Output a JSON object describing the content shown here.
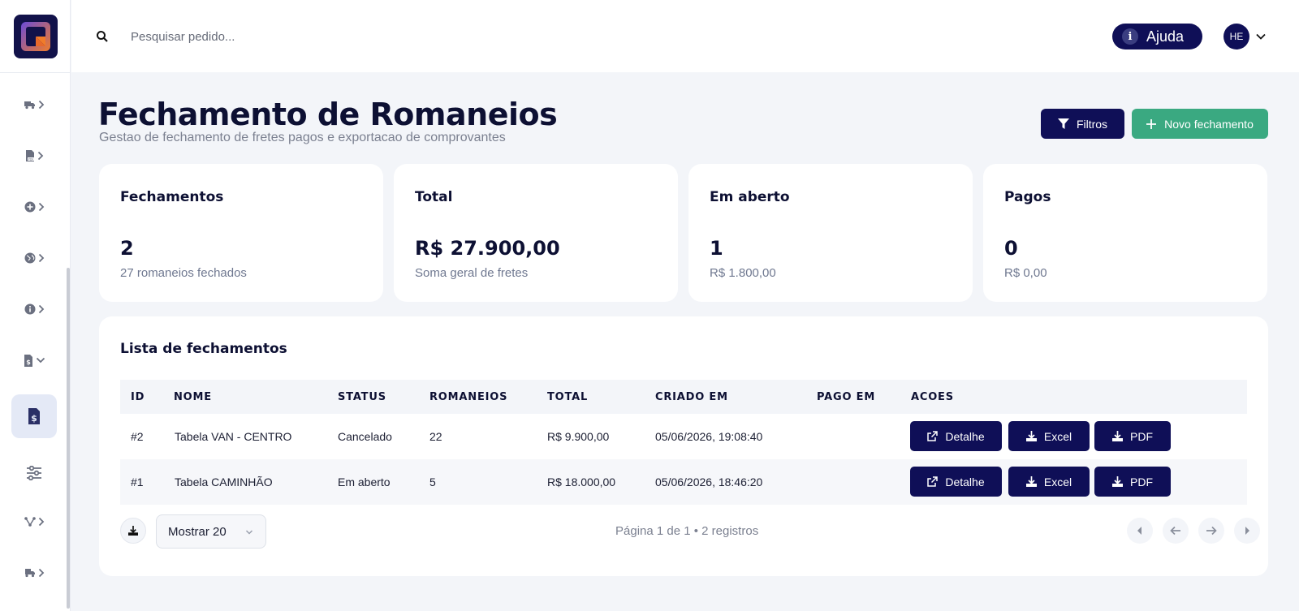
{
  "topbar": {
    "search_placeholder": "Pesquisar pedido...",
    "help_label": "Ajuda",
    "avatar_initials": "HE"
  },
  "sidebar": {
    "items": [
      {
        "icon": "truck-icon",
        "expandable": "chevron-right"
      },
      {
        "icon": "pdf-file-icon",
        "expandable": "chevron-right"
      },
      {
        "icon": "plus-circle-icon",
        "expandable": "chevron-right"
      },
      {
        "icon": "globe-icon",
        "expandable": "chevron-right"
      },
      {
        "icon": "info-circle-icon",
        "expandable": "chevron-right"
      },
      {
        "icon": "dollar-file-icon",
        "expandable": "chevron-down"
      },
      {
        "icon": "dollar-file-icon",
        "active": true
      },
      {
        "icon": "sliders-icon"
      },
      {
        "icon": "route-icon",
        "expandable": "chevron-right"
      },
      {
        "icon": "truck-loading-icon",
        "expandable": "chevron-right"
      }
    ]
  },
  "header": {
    "title": "Fechamento de Romaneios",
    "subtitle": "Gestao de fechamento de fretes pagos e exportacao de comprovantes",
    "filter_label": "Filtros",
    "new_label": "Novo fechamento"
  },
  "stats": [
    {
      "label": "Fechamentos",
      "value": "2",
      "sub": "27 romaneios fechados"
    },
    {
      "label": "Total",
      "value": "R$ 27.900,00",
      "sub": "Soma geral de fretes"
    },
    {
      "label": "Em aberto",
      "value": "1",
      "sub": "R$ 1.800,00"
    },
    {
      "label": "Pagos",
      "value": "0",
      "sub": "R$ 0,00"
    }
  ],
  "list": {
    "title": "Lista de fechamentos",
    "columns": [
      "ID",
      "NOME",
      "STATUS",
      "ROMANEIOS",
      "TOTAL",
      "CRIADO EM",
      "PAGO EM",
      "ACOES"
    ],
    "rows": [
      {
        "id": "#2",
        "nome": "Tabela VAN - CENTRO",
        "status": "Cancelado",
        "romaneios": "22",
        "total": "R$ 9.900,00",
        "criado_em": "05/06/2026, 19:08:40",
        "pago_em": ""
      },
      {
        "id": "#1",
        "nome": "Tabela CAMINHÃO",
        "status": "Em aberto",
        "romaneios": "5",
        "total": "R$ 18.000,00",
        "criado_em": "05/06/2026, 18:46:20",
        "pago_em": ""
      }
    ],
    "actions": {
      "detail": "Detalhe",
      "excel": "Excel",
      "pdf": "PDF"
    }
  },
  "pagination": {
    "page_size": "Mostrar 20",
    "info": "Página 1 de 1 • 2 registros"
  },
  "colors": {
    "primary": "#0f0f57",
    "success": "#3aa981",
    "background": "#f3f5f9"
  }
}
